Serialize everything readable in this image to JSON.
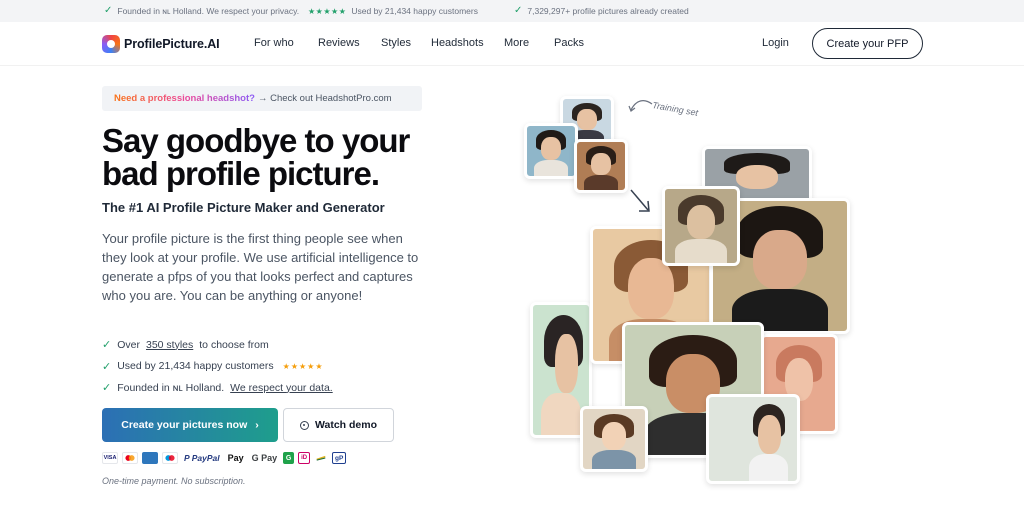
{
  "topbar": {
    "item1": "Founded in ɴʟ Holland. We respect your privacy.",
    "item2_stars": "★★★★★",
    "item2": "Used by 21,434 happy customers",
    "item3": "7,329,297+ profile pictures already created"
  },
  "nav": {
    "brand": "ProfilePicture.AI",
    "links": [
      "For who",
      "Reviews",
      "Styles",
      "Headshots",
      "More",
      "Packs"
    ],
    "login": "Login",
    "cta": "Create your PFP"
  },
  "hero": {
    "promo_highlight": "Need a professional headshot?",
    "promo_rest": "→ Check out HeadshotPro.com",
    "headline": "Say goodbye to your bad profile picture.",
    "subhead": "The #1 AI Profile Picture Maker and Generator",
    "description": "Your profile picture is the first thing people see when they look at your profile. We use artificial intelligence to generate a pfps of you that looks perfect and captures who you are. You can be anything or anyone!",
    "checks": {
      "c1_pre": "Over",
      "c1_link": "350 styles",
      "c1_post": "to choose from",
      "c2": "Used by 21,434 happy customers",
      "c2_stars": "★★★★★",
      "c3_pre": "Founded in ɴʟ Holland.",
      "c3_link": "We respect your data."
    },
    "primary_button": "Create your pictures now",
    "primary_button_arrow": "›",
    "secondary_button": "Watch demo",
    "payments": [
      "VISA",
      "Mastercard",
      "Amex",
      "Maestro",
      "PayPal",
      "Apple Pay",
      "G Pay",
      "G",
      "iDEAL",
      "Klarna",
      "GiroPay"
    ],
    "payment_labels": {
      "visa": "VISA",
      "paypal": "P PayPal",
      "applepay": " Pay",
      "gpay": "G Pay"
    },
    "note": "One-time payment. No subscription."
  },
  "collage": {
    "training_label": "Training set"
  },
  "colors": {
    "accent_green": "#22a06b",
    "primary_gradient_start": "#2c6fb5",
    "primary_gradient_end": "#1e9e8c",
    "star_gold": "#f59e0b"
  }
}
